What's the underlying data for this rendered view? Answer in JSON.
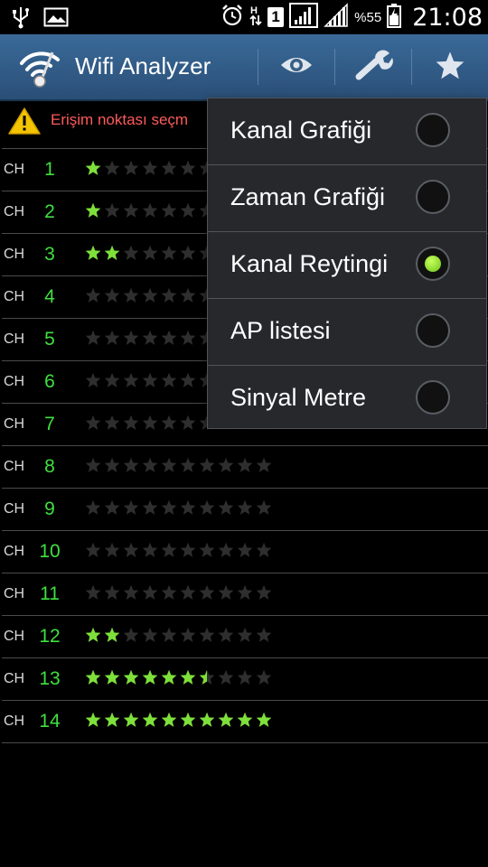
{
  "status_bar": {
    "battery_percent": "%55",
    "time": "21:08",
    "sim_label": "1",
    "icons": [
      "usb-icon",
      "picture-icon",
      "alarm-icon",
      "data-transfer-icon",
      "sim-icon",
      "signal-icon",
      "signal-icon",
      "battery-icon"
    ]
  },
  "action_bar": {
    "title": "Wifi Analyzer",
    "buttons": [
      "eye-icon",
      "wrench-icon",
      "star-icon"
    ]
  },
  "warning": {
    "text": "Erişim noktası seçm"
  },
  "channels": {
    "prefix": "CH",
    "max_stars": 10,
    "colors": {
      "filled_star": "#7ee03a",
      "empty_star": "#2e2e2e",
      "channel_number": "#3fe03f"
    },
    "rows": [
      {
        "number": "1",
        "rating": 1
      },
      {
        "number": "2",
        "rating": 1
      },
      {
        "number": "3",
        "rating": 2
      },
      {
        "number": "4",
        "rating": 0
      },
      {
        "number": "5",
        "rating": 0
      },
      {
        "number": "6",
        "rating": 0
      },
      {
        "number": "7",
        "rating": 0
      },
      {
        "number": "8",
        "rating": 0
      },
      {
        "number": "9",
        "rating": 0
      },
      {
        "number": "10",
        "rating": 0
      },
      {
        "number": "11",
        "rating": 0
      },
      {
        "number": "12",
        "rating": 2
      },
      {
        "number": "13",
        "rating": 6.5
      },
      {
        "number": "14",
        "rating": 10
      }
    ]
  },
  "menu": {
    "items": [
      {
        "label": "Kanal Grafiği",
        "selected": false
      },
      {
        "label": "Zaman Grafiği",
        "selected": false
      },
      {
        "label": "Kanal Reytingi",
        "selected": true
      },
      {
        "label": "AP listesi",
        "selected": false
      },
      {
        "label": "Sinyal Metre",
        "selected": false
      }
    ]
  }
}
